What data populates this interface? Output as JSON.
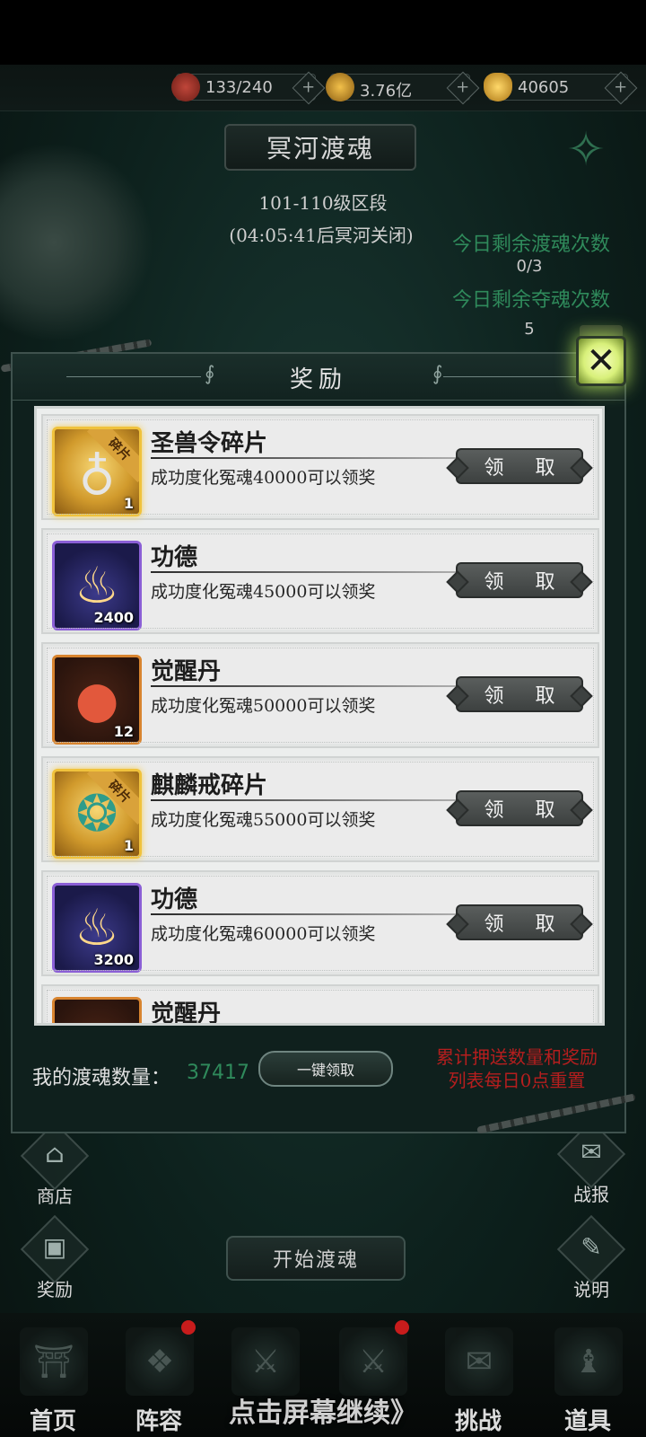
{
  "resources": [
    {
      "icon": "stamina-orb-icon",
      "value": "133/240"
    },
    {
      "icon": "coin-icon",
      "value": "3.76亿"
    },
    {
      "icon": "gold-ingot-icon",
      "value": "40605"
    }
  ],
  "header": {
    "title": "冥河渡魂",
    "level_range": "101-110级区段",
    "countdown": "(04:05:41后冥河关闭)",
    "remaining_ferry_label": "今日剩余渡魂次数",
    "remaining_ferry_value": "0/3",
    "remaining_seize_label": "今日剩余夺魂次数",
    "remaining_seize_value": "5"
  },
  "modal": {
    "title": "奖励",
    "rewards": [
      {
        "name": "圣兽令碎片",
        "desc": "成功度化冤魂40000可以领奖",
        "count": "1",
        "badge": "碎片",
        "style": "gold",
        "icon": "beast-token-icon",
        "button": "领 取"
      },
      {
        "name": "功德",
        "desc": "成功度化冤魂45000可以领奖",
        "count": "2400",
        "badge": "",
        "style": "purple",
        "icon": "flame-icon",
        "button": "领 取"
      },
      {
        "name": "觉醒丹",
        "desc": "成功度化冤魂50000可以领奖",
        "count": "12",
        "badge": "",
        "style": "orange",
        "icon": "pill-icon",
        "button": "领 取"
      },
      {
        "name": "麒麟戒碎片",
        "desc": "成功度化冤魂55000可以领奖",
        "count": "1",
        "badge": "碎片",
        "style": "gold",
        "icon": "qilin-ring-icon",
        "button": "领 取"
      },
      {
        "name": "功德",
        "desc": "成功度化冤魂60000可以领奖",
        "count": "3200",
        "badge": "",
        "style": "purple",
        "icon": "flame-icon",
        "button": "领 取"
      },
      {
        "name": "觉醒丹",
        "desc": "",
        "count": "",
        "badge": "",
        "style": "orange",
        "icon": "pill-icon",
        "button": ""
      }
    ],
    "my_count_label": "我的渡魂数量：",
    "my_count_value": "37417",
    "claim_all": "一键领取",
    "reset_note_line1": "累计押送数量和奖励",
    "reset_note_line2": "列表每日0点重置"
  },
  "side_buttons": {
    "shop": "商店",
    "rewards": "奖励",
    "battle_report": "战报",
    "help": "说明"
  },
  "start_button": "开始渡魂",
  "bottom_nav": [
    "首页",
    "阵容",
    "",
    "",
    "挑战",
    "道具"
  ],
  "continue_hint": "点击屏幕继续》",
  "colors": {
    "accent_green": "#2f8a5b",
    "notice_red": "#b51e1e",
    "button_gray": "#4a4e4d"
  }
}
